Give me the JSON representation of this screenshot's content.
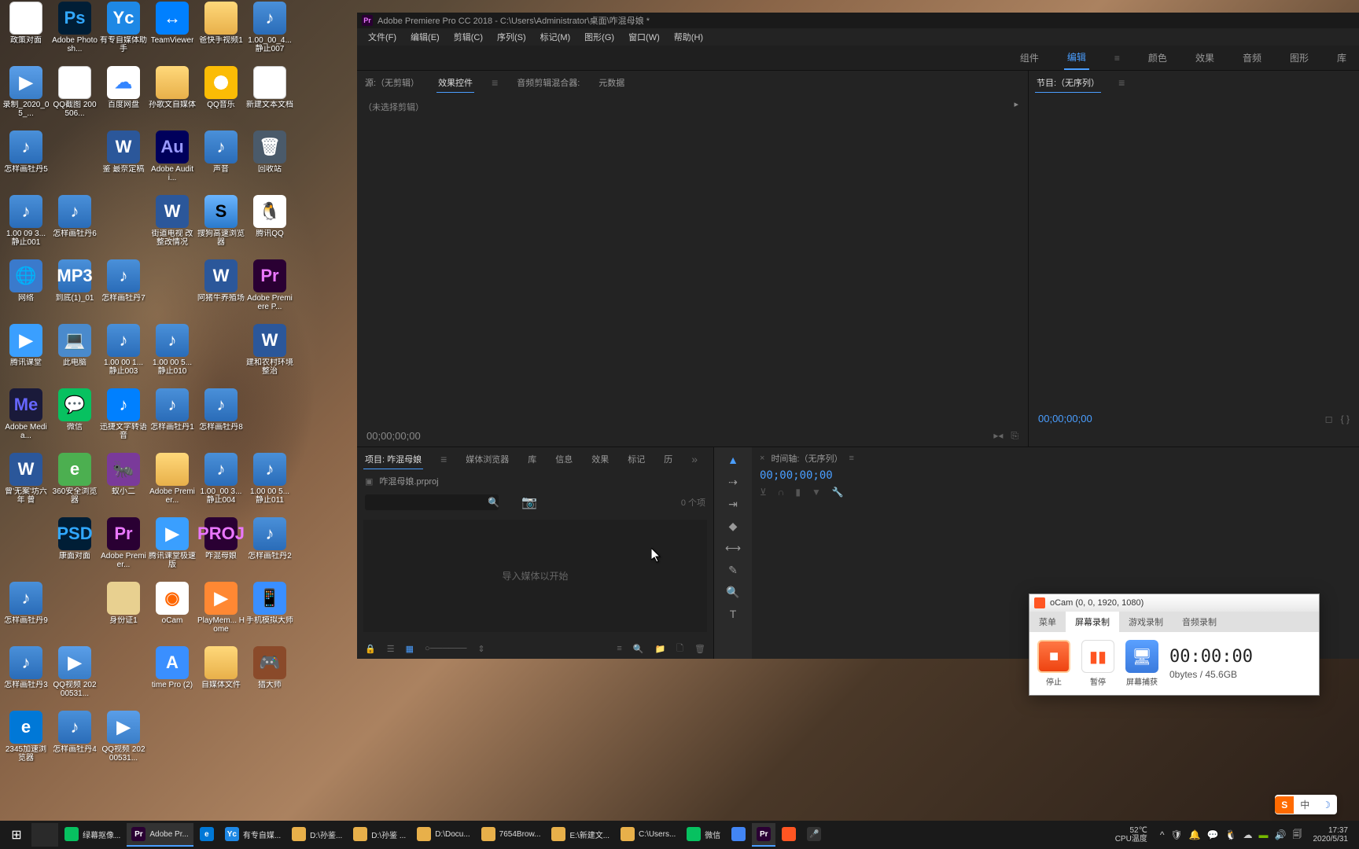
{
  "desktop_icons": [
    {
      "l": "政策对面",
      "c": "ic-doc"
    },
    {
      "l": "Adobe Photosh...",
      "c": "ic-ps",
      "t": "Ps"
    },
    {
      "l": "有专自媒体助手",
      "c": "ic-yc",
      "t": "Yc"
    },
    {
      "l": "TeamViewer",
      "c": "ic-tv",
      "t": "↔"
    },
    {
      "l": "爸快手视频1",
      "c": "ic-fold"
    },
    {
      "l": "1.00_00_4... 静止007",
      "c": "ic-mp3",
      "t": "♪"
    },
    {
      "l": "录制_2020_05_...",
      "c": "ic-mp4",
      "t": "▶"
    },
    {
      "l": "QQ截图 200506...",
      "c": "ic-doc"
    },
    {
      "l": "百度网盘",
      "c": "ic-bd",
      "t": "☁"
    },
    {
      "l": "孙歌文自媒体",
      "c": "ic-fold"
    },
    {
      "l": "QQ音乐",
      "c": "ic-qq"
    },
    {
      "l": "新建文本文档",
      "c": "ic-doc"
    },
    {
      "l": "怎样画牡丹5",
      "c": "ic-mp3",
      "t": "♪"
    },
    {
      "l": "",
      "c": ""
    },
    {
      "l": "鉴 最奈定稿",
      "c": "ic-word",
      "t": "W"
    },
    {
      "l": "Adobe Auditi...",
      "c": "ic-au",
      "t": "Au"
    },
    {
      "l": "声音",
      "c": "ic-mp3",
      "t": "♪"
    },
    {
      "l": "回收站",
      "c": "ic-bin",
      "t": "🗑"
    },
    {
      "l": "1.00 09 3... 静止001",
      "c": "ic-mp3",
      "t": "♪"
    },
    {
      "l": "怎样画牡丹6",
      "c": "ic-mp3",
      "t": "♪"
    },
    {
      "l": "",
      "c": ""
    },
    {
      "l": "街道电视 改整改情况",
      "c": "ic-word",
      "t": "W"
    },
    {
      "l": "搜狗高速浏览器",
      "c": "ic-sg",
      "t": "S"
    },
    {
      "l": "腾讯QQ",
      "c": "ic-qp",
      "t": "🐧"
    },
    {
      "l": "网络",
      "c": "ic-net",
      "t": "🌐"
    },
    {
      "l": "到底(1)_01",
      "c": "ic-mp3",
      "t": "MP3"
    },
    {
      "l": "怎样画牡丹7",
      "c": "ic-mp3",
      "t": "♪"
    },
    {
      "l": "",
      "c": ""
    },
    {
      "l": "阿猪牛养殖场",
      "c": "ic-word",
      "t": "W"
    },
    {
      "l": "Adobe Premiere P...",
      "c": "ic-pr",
      "t": "Pr"
    },
    {
      "l": "腾讯课堂",
      "c": "ic-tx",
      "t": "▶"
    },
    {
      "l": "此电脑",
      "c": "ic-pc",
      "t": "💻"
    },
    {
      "l": "1.00 00 1... 静止003",
      "c": "ic-mp3",
      "t": "♪"
    },
    {
      "l": "1.00 00 5... 静止010",
      "c": "ic-mp3",
      "t": "♪"
    },
    {
      "l": "",
      "c": ""
    },
    {
      "l": "建和农村环境整治",
      "c": "ic-word",
      "t": "W"
    },
    {
      "l": "Adobe Media...",
      "c": "ic-me",
      "t": "Me"
    },
    {
      "l": "微信",
      "c": "ic-wx",
      "t": "💬"
    },
    {
      "l": "迅捷文字转语音",
      "c": "ic-xj",
      "t": "♪"
    },
    {
      "l": "怎样画牡丹1",
      "c": "ic-mp3",
      "t": "♪"
    },
    {
      "l": "怎样画牡丹8",
      "c": "ic-mp3",
      "t": "♪"
    },
    {
      "l": "",
      "c": ""
    },
    {
      "l": "曾'无案'坊六年 曾",
      "c": "ic-word",
      "t": "W"
    },
    {
      "l": "360安全浏览器",
      "c": "ic-360",
      "t": "e"
    },
    {
      "l": "蚁小二",
      "c": "ic-yx",
      "t": "🐜"
    },
    {
      "l": "Adobe Premier...",
      "c": "ic-fold"
    },
    {
      "l": "1.00_00 3... 静止004",
      "c": "ic-mp3",
      "t": "♪"
    },
    {
      "l": "1.00 00 5... 静止011",
      "c": "ic-mp3",
      "t": "♪"
    },
    {
      "l": "",
      "c": ""
    },
    {
      "l": "康面对面",
      "c": "ic-ps",
      "t": "PSD"
    },
    {
      "l": "Adobe Premier...",
      "c": "ic-pr",
      "t": "Pr"
    },
    {
      "l": "腾讯课堂极速版",
      "c": "ic-tx",
      "t": "▶"
    },
    {
      "l": "咋混母娘",
      "c": "ic-proj",
      "t": "PROJ"
    },
    {
      "l": "怎样画牡丹2",
      "c": "ic-mp3",
      "t": "♪"
    },
    {
      "l": "怎样画牡丹9",
      "c": "ic-mp3",
      "t": "♪"
    },
    {
      "l": "",
      "c": ""
    },
    {
      "l": "身份证1",
      "c": "ic-id"
    },
    {
      "l": "oCam",
      "c": "ic-oc",
      "t": "◉"
    },
    {
      "l": "PlayMem... Home",
      "c": "ic-pm",
      "t": "▶"
    },
    {
      "l": "手机模拟大师",
      "c": "ic-ph",
      "t": "📱"
    },
    {
      "l": "怎样画牡丹3",
      "c": "ic-mp3",
      "t": "♪"
    },
    {
      "l": "QQ视频 20200531...",
      "c": "ic-mp4",
      "t": "▶"
    },
    {
      "l": "",
      "c": ""
    },
    {
      "l": "time Pro (2)",
      "c": "ic-a",
      "t": "A"
    },
    {
      "l": "自媒体文件",
      "c": "ic-fold"
    },
    {
      "l": "猎大师",
      "c": "ic-hd",
      "t": "🎮"
    },
    {
      "l": "2345加速浏览器",
      "c": "ic-ie",
      "t": "e"
    },
    {
      "l": "怎样画牡丹4",
      "c": "ic-mp3",
      "t": "♪"
    },
    {
      "l": "QQ视频 20200531...",
      "c": "ic-mp4",
      "t": "▶"
    },
    {
      "l": "",
      "c": ""
    }
  ],
  "premiere": {
    "title": "Adobe Premiere Pro CC 2018 - C:\\Users\\Administrator\\桌面\\咋混母娘 *",
    "menu": [
      "文件(F)",
      "编辑(E)",
      "剪辑(C)",
      "序列(S)",
      "标记(M)",
      "图形(G)",
      "窗口(W)",
      "帮助(H)"
    ],
    "workspaces": [
      "组件",
      "编辑",
      "颜色",
      "效果",
      "音频",
      "图形",
      "库"
    ],
    "ws_active": "编辑",
    "src_tabs": [
      "源:（无剪辑）",
      "效果控件",
      "音频剪辑混合器:",
      "元数据"
    ],
    "src_active": "效果控件",
    "src_text": "（未选择剪辑）",
    "src_tc": "00;00;00;00",
    "prog_label": "节目:（无序列）",
    "prog_tc": "00;00;00;00",
    "proj_tabs": [
      "项目: 咋混母娘",
      "媒体浏览器",
      "库",
      "信息",
      "效果",
      "标记",
      "历"
    ],
    "proj_file": "咋混母娘.prproj",
    "proj_count": "0 个项",
    "proj_drop": "导入媒体以开始",
    "tl_label": "时间轴:（无序列）",
    "tl_tc": "00;00;00;00",
    "search_ph": ""
  },
  "ocam": {
    "title": "oCam (0, 0, 1920, 1080)",
    "tabs": [
      "菜单",
      "屏幕录制",
      "游戏录制",
      "音频录制"
    ],
    "tab_active": "屏幕录制",
    "stop": "停止",
    "pause": "暂停",
    "capture": "屏幕捕获",
    "time": "00:00:00",
    "size": "0bytes / 45.6GB"
  },
  "taskbar": {
    "items": [
      {
        "l": "绿幕抠像...",
        "c": "#07c160",
        "t": ""
      },
      {
        "l": "Adobe Pr...",
        "c": "#2a0033",
        "t": "Pr",
        "a": true
      },
      {
        "l": "",
        "c": "#0078d7",
        "t": "e"
      },
      {
        "l": "有专自媒...",
        "c": "#1e88e5",
        "t": "Yc"
      },
      {
        "l": "D:\\孙鉴...",
        "c": "#e8b04a",
        "t": ""
      },
      {
        "l": "D:\\孙鉴 ...",
        "c": "#e8b04a",
        "t": ""
      },
      {
        "l": "D:\\Docu...",
        "c": "#e8b04a",
        "t": ""
      },
      {
        "l": "7654Brow...",
        "c": "#e8b04a",
        "t": ""
      },
      {
        "l": "E:\\新建文...",
        "c": "#e8b04a",
        "t": ""
      },
      {
        "l": "C:\\Users...",
        "c": "#e8b04a",
        "t": ""
      },
      {
        "l": "微信",
        "c": "#07c160",
        "t": ""
      },
      {
        "l": "",
        "c": "#4285f4",
        "t": ""
      },
      {
        "l": "",
        "c": "#2a0033",
        "t": "Pr",
        "a": true
      },
      {
        "l": "",
        "c": "#ff5522",
        "t": ""
      },
      {
        "l": "",
        "c": "#333",
        "t": "🎤"
      }
    ],
    "temp": "52℃",
    "temp_lbl": "CPU温度",
    "time": "17:37",
    "date": "2020/5/31"
  },
  "ime": {
    "s1": "S",
    "s2": "中",
    "s3": "☽"
  }
}
